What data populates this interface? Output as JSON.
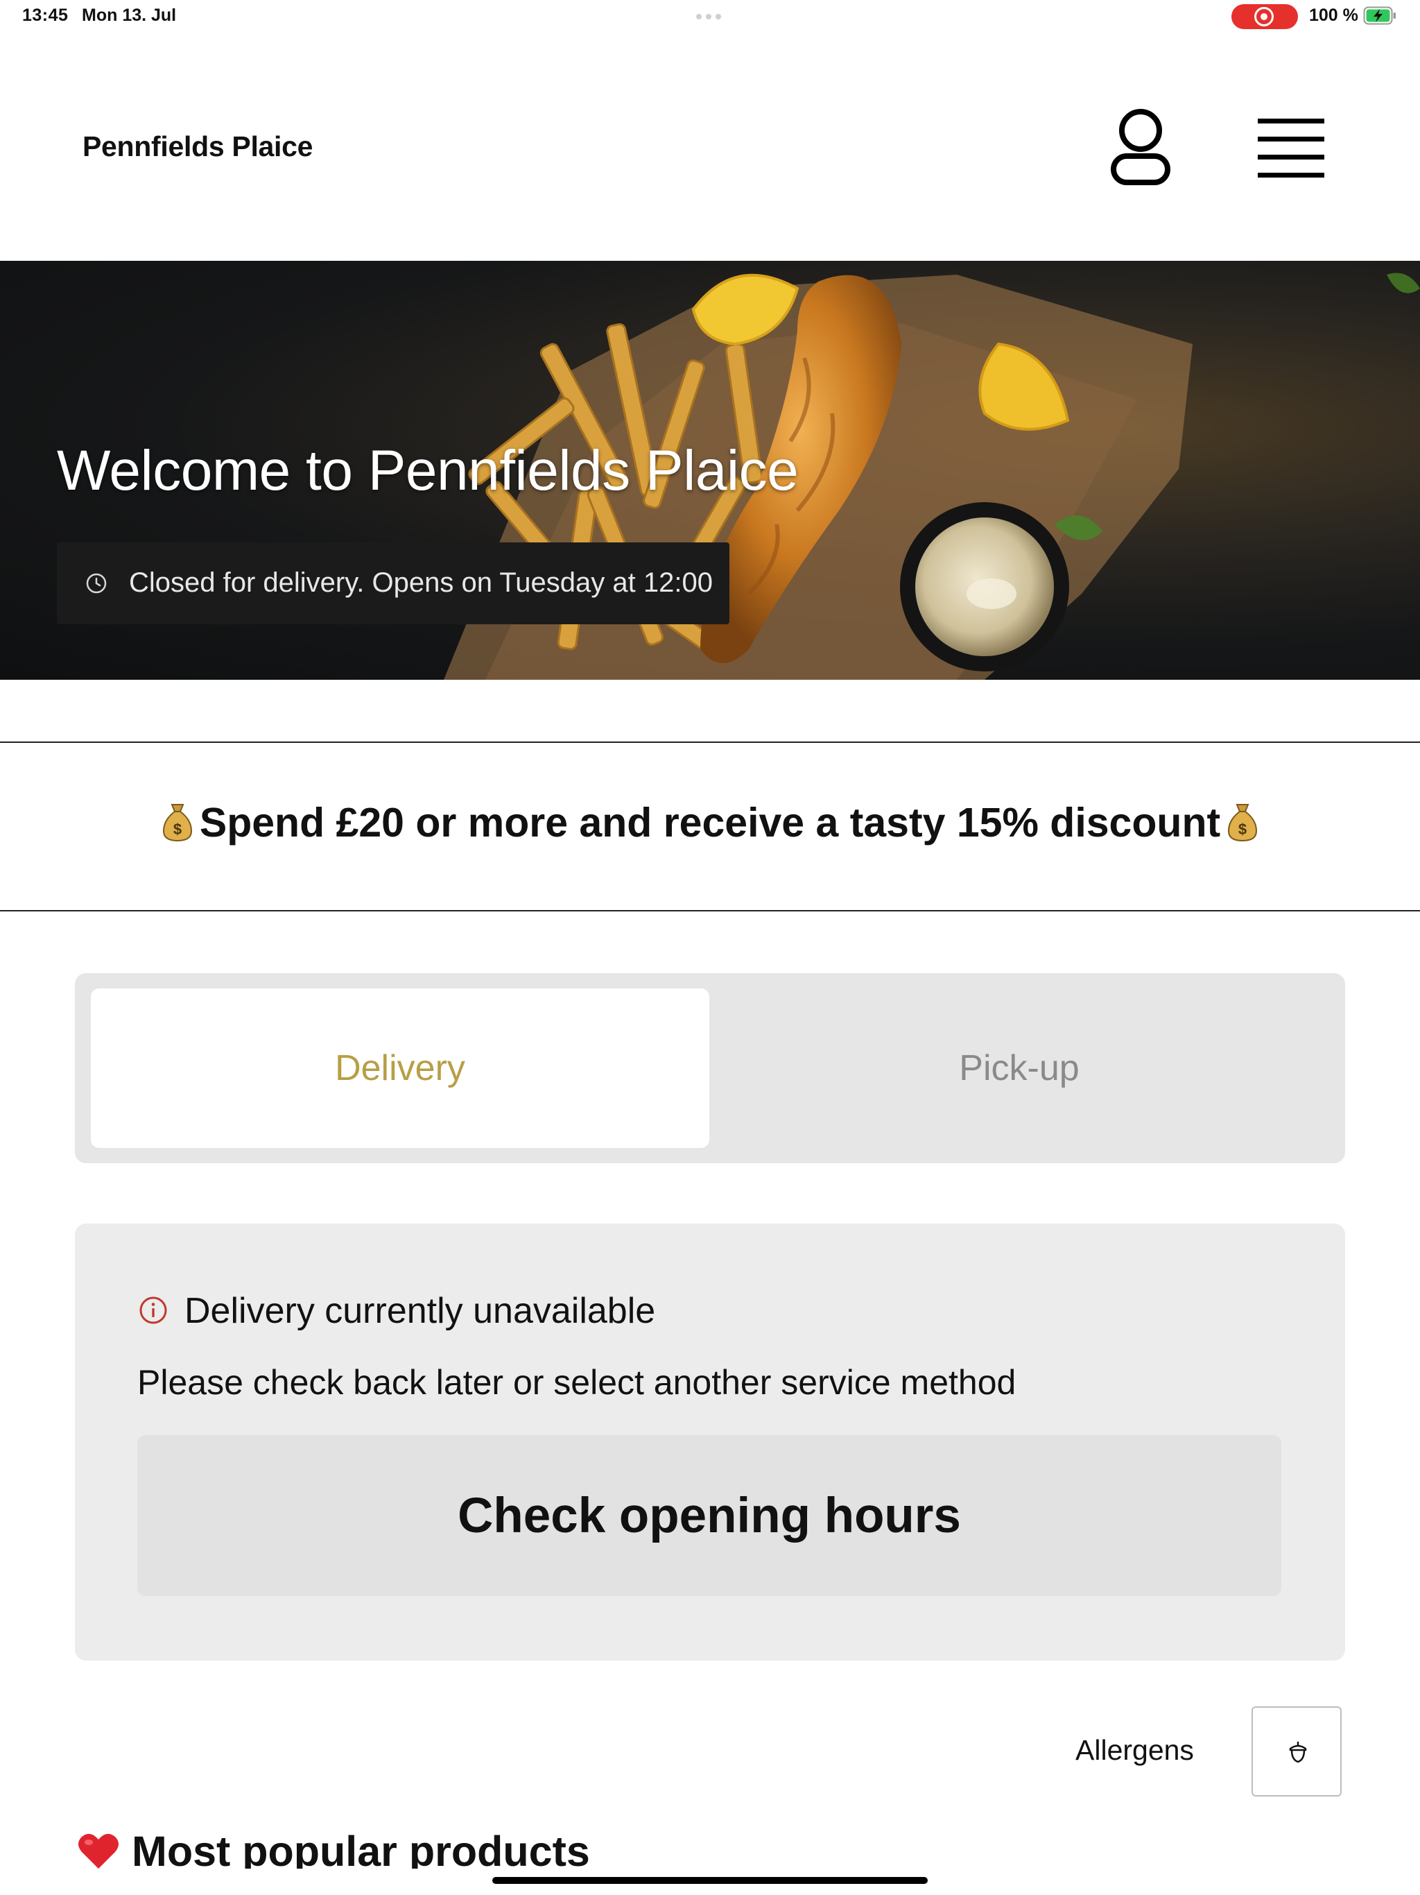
{
  "status_bar": {
    "time": "13:45",
    "date": "Mon 13. Jul",
    "battery": "100 %"
  },
  "header": {
    "brand": "Pennfields Plaice",
    "user_icon": "user-icon",
    "menu_icon": "hamburger-menu-icon"
  },
  "hero": {
    "title": "Welcome to Pennfields Plaice",
    "status": "Closed for delivery. Opens on Tuesday at 12:00",
    "status_icon": "clock-icon"
  },
  "promo": {
    "text": "Spend £20 or more and receive a tasty 15% discount",
    "icon": "money-bag-icon"
  },
  "service": {
    "options": [
      "Delivery",
      "Pick-up"
    ],
    "selected": "Delivery",
    "active_color": "#b79f45"
  },
  "notice": {
    "title": "Delivery currently unavailable",
    "body": "Please check back later or select another service method",
    "button": "Check opening hours",
    "icon_color": "#c0392b"
  },
  "allergens": {
    "label": "Allergens",
    "icon": "acorn-icon"
  },
  "popular": {
    "title": "Most popular products",
    "icon": "heart-icon"
  }
}
